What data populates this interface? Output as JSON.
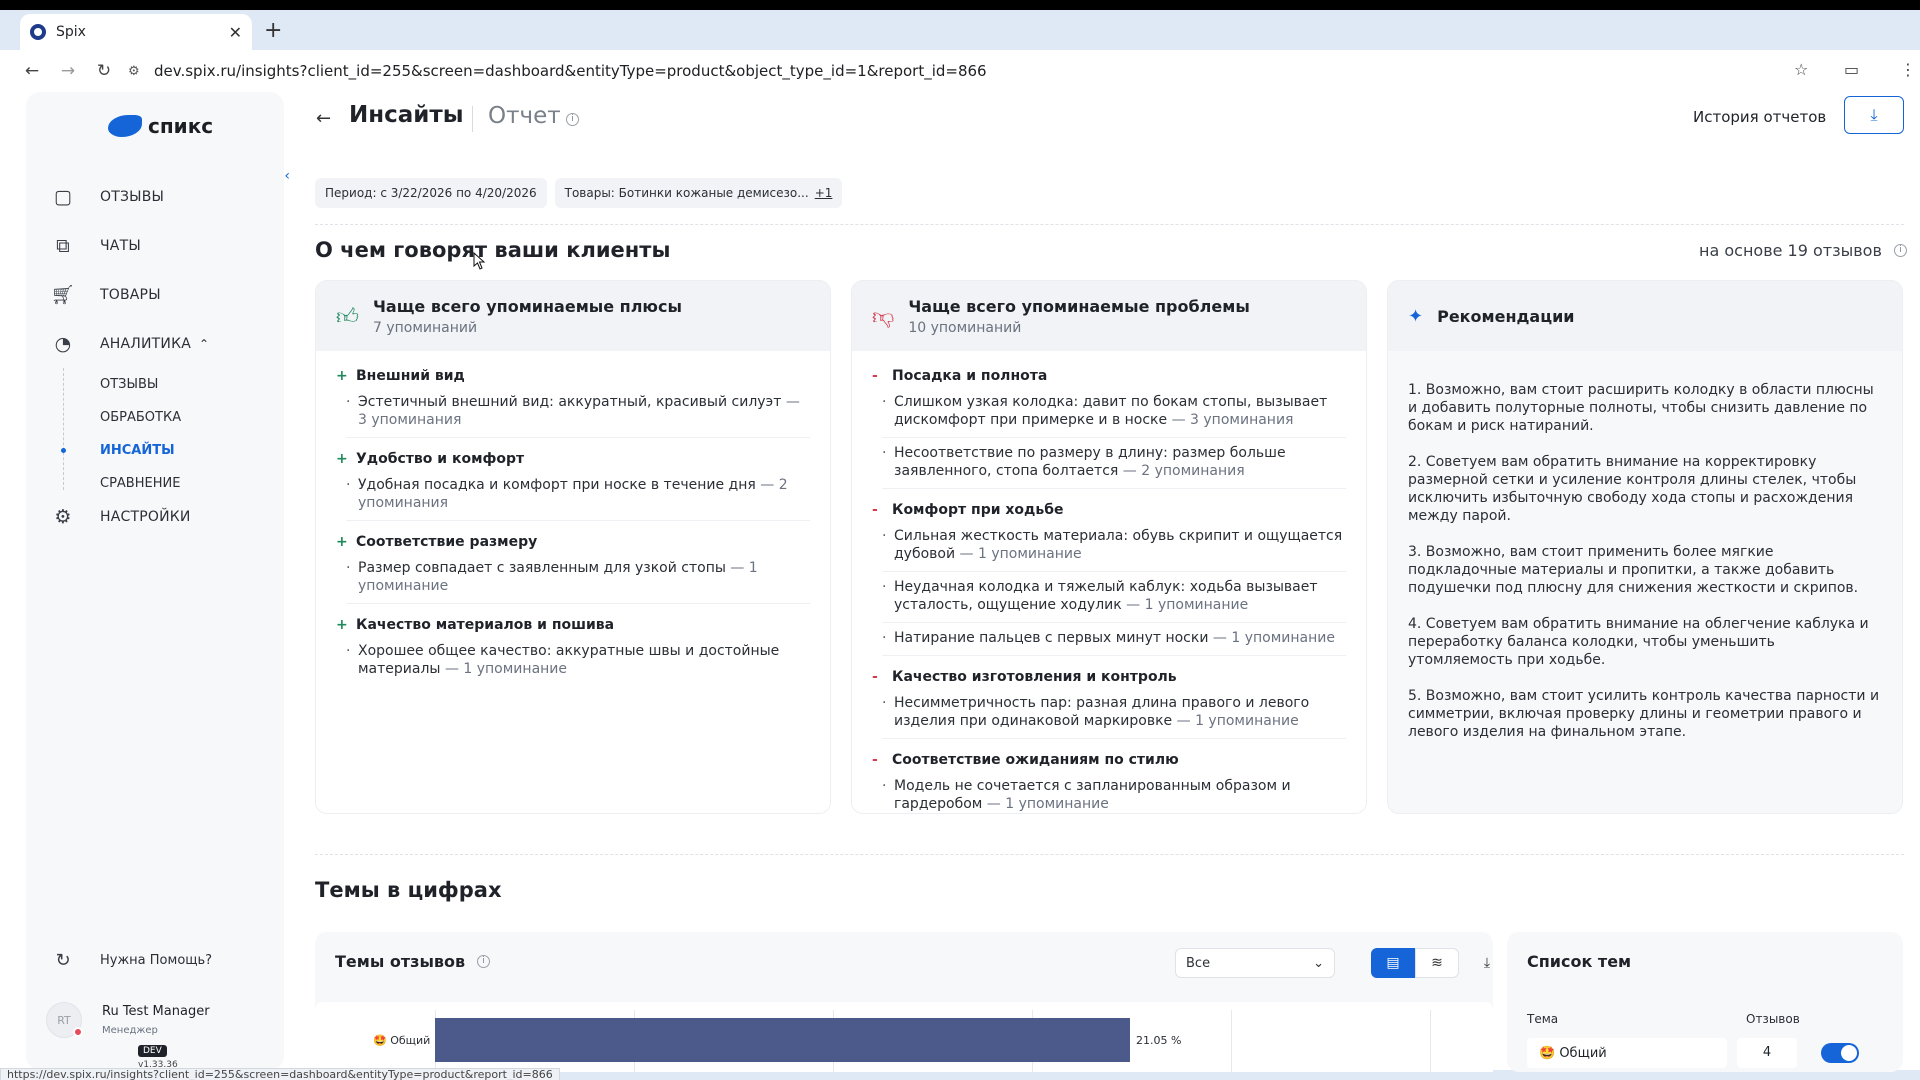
{
  "browser": {
    "tab_title": "Spix",
    "url": "dev.spix.ru/insights?client_id=255&screen=dashboard&entityType=product&object_type_id=1&report_id=866",
    "status_url": "https://dev.spix.ru/insights?client_id=255&screen=dashboard&entityType=product&report_id=866"
  },
  "sidebar": {
    "logo_text": "спикс",
    "items": [
      {
        "label": "ОТЗЫВЫ",
        "icon": "message-square-icon"
      },
      {
        "label": "ЧАТЫ",
        "icon": "chats-icon"
      },
      {
        "label": "ТОВАРЫ",
        "icon": "cart-icon"
      },
      {
        "label": "АНАЛИТИКА",
        "icon": "pie-chart-icon"
      }
    ],
    "sub_items": [
      "ОТЗЫВЫ",
      "ОБРАБОТКА",
      "ИНСАЙТЫ",
      "СРАВНЕНИЕ"
    ],
    "active_sub": "ИНСАЙТЫ",
    "settings_label": "НАСТРОЙКИ",
    "help_label": "Нужна Помощь?",
    "user_name": "Ru Test Manager",
    "user_role": "Менеджер",
    "user_initials": "RT",
    "env_badge": "DEV",
    "version": "v1.33.36"
  },
  "header": {
    "title": "Инсайты",
    "subtitle": "Отчет",
    "history_label": "История отчетов"
  },
  "filters": {
    "period": "Период: с 3/22/2026 по 4/20/2026",
    "products": "Товары: Ботинки кожаные демисезо...",
    "products_more": "+1"
  },
  "section1": {
    "title": "О чем говорят ваши клиенты",
    "based_on": "на основе 19 отзывов"
  },
  "pros": {
    "title": "Чаще всего упоминаемые плюсы",
    "count": "7 упоминаний",
    "groups": [
      {
        "title": "Внешний вид",
        "points": [
          {
            "text": "Эстетичный внешний вид: аккуратный, красивый силуэт",
            "mentions": "— 3 упоминания"
          }
        ]
      },
      {
        "title": "Удобство и комфорт",
        "points": [
          {
            "text": "Удобная посадка и комфорт при носке в течение дня",
            "mentions": "— 2 упоминания"
          }
        ]
      },
      {
        "title": "Соответствие размеру",
        "points": [
          {
            "text": "Размер совпадает с заявленным для узкой стопы",
            "mentions": "— 1 упоминание"
          }
        ]
      },
      {
        "title": "Качество материалов и пошива",
        "points": [
          {
            "text": "Хорошее общее качество: аккуратные швы и достойные материалы",
            "mentions": "— 1 упоминание"
          }
        ]
      }
    ]
  },
  "cons": {
    "title": "Чаще всего упоминаемые проблемы",
    "count": "10 упоминаний",
    "groups": [
      {
        "title": "Посадка и полнота",
        "points": [
          {
            "text": "Слишком узкая колодка: давит по бокам стопы, вызывает дискомфорт при примерке и в носке",
            "mentions": "— 3 упоминания"
          },
          {
            "text": "Несоответствие по размеру в длину: размер больше заявленного, стопа болтается",
            "mentions": "— 2 упоминания"
          }
        ]
      },
      {
        "title": "Комфорт при ходьбе",
        "points": [
          {
            "text": "Сильная жесткость материала: обувь скрипит и ощущается дубовой",
            "mentions": "— 1 упоминание"
          },
          {
            "text": "Неудачная колодка и тяжелый каблук: ходьба вызывает усталость, ощущение ходулик",
            "mentions": "— 1 упоминание"
          },
          {
            "text": "Натирание пальцев с первых минут носки",
            "mentions": "— 1 упоминание"
          }
        ]
      },
      {
        "title": "Качество изготовления и контроль",
        "points": [
          {
            "text": "Несимметричность пар: разная длина правого и левого изделия при одинаковой маркировке",
            "mentions": "— 1 упоминание"
          }
        ]
      },
      {
        "title": "Соответствие ожиданиям по стилю",
        "points": [
          {
            "text": "Модель не сочетается с запланированным образом и гардеробом",
            "mentions": "— 1 упоминание"
          }
        ]
      }
    ]
  },
  "recommendations": {
    "title": "Рекомендации",
    "items": [
      "1. Возможно, вам стоит расширить колодку в области плюсны и добавить полуторные полноты, чтобы снизить давление по бокам и риск натираний.",
      "2. Советуем вам обратить внимание на корректировку размерной сетки и усиление контроля длины стелек, чтобы исключить избыточную свободу хода стопы и расхождения между парой.",
      "3. Возможно, вам стоит применить более мягкие подкладочные материалы и пропитки, а также добавить подушечки под плюсну для снижения жесткости и скрипов.",
      "4. Советуем вам обратить внимание на облегчение каблука и переработку баланса колодки, чтобы уменьшить утомляемость при ходьбе.",
      "5. Возможно, вам стоит усилить контроль качества парности и симметрии, включая проверку длины и геометрии правого и левого изделия на финальном этапе."
    ]
  },
  "section2": {
    "title": "Темы в цифрах",
    "chart_card_title": "Темы отзывов",
    "filter_value": "Все",
    "topics_title": "Список тем",
    "col_topic": "Тема",
    "col_reviews": "Отзывов",
    "topic_row": {
      "emoji": "🤩",
      "name": "Общий",
      "reviews": "4"
    }
  },
  "chart_data": {
    "type": "bar",
    "categories": [
      "🤩 Общий"
    ],
    "values": [
      21.05
    ],
    "value_labels": [
      "21.05 %"
    ]
  },
  "colors": {
    "accent": "#1565d8",
    "bar": "#4b5a8a",
    "plus": "#1f8a5c",
    "minus": "#d43b4f"
  }
}
